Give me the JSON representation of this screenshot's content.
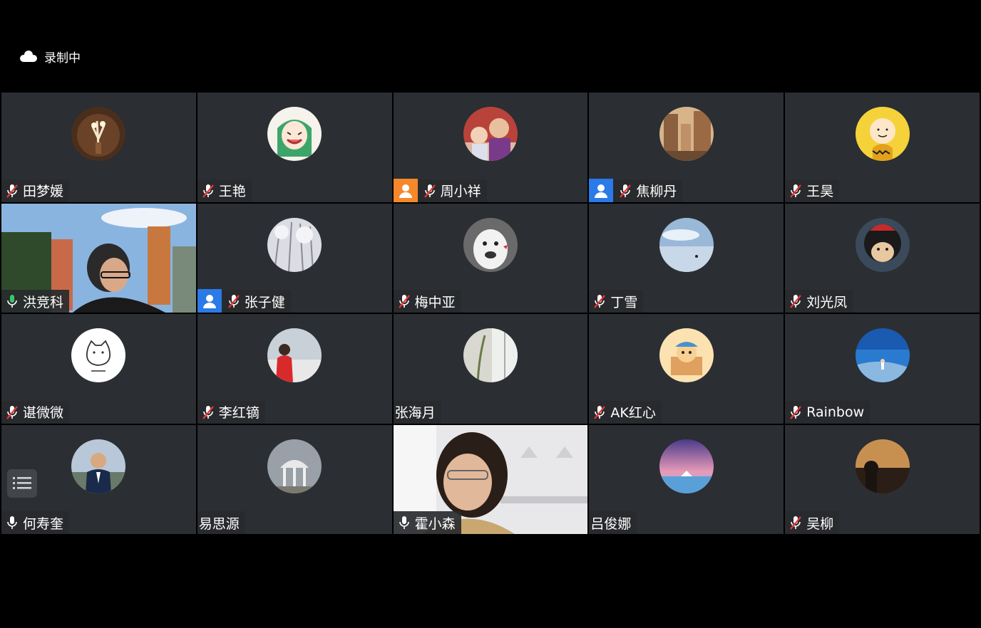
{
  "recording": {
    "label": "录制中"
  },
  "participants": [
    {
      "name": "田梦媛",
      "mic": "muted"
    },
    {
      "name": "王艳",
      "mic": "muted"
    },
    {
      "name": "周小祥",
      "mic": "muted",
      "role": "host"
    },
    {
      "name": "焦柳丹",
      "mic": "muted",
      "role": "cohost"
    },
    {
      "name": "王昊",
      "mic": "muted"
    },
    {
      "name": "洪竞科",
      "mic": "speaking",
      "video": true
    },
    {
      "name": "张子健",
      "mic": "muted",
      "role": "cohost"
    },
    {
      "name": "梅中亚",
      "mic": "muted"
    },
    {
      "name": "丁雪",
      "mic": "muted"
    },
    {
      "name": "刘光凤",
      "mic": "muted"
    },
    {
      "name": "谌微微",
      "mic": "muted"
    },
    {
      "name": "李红镝",
      "mic": "muted"
    },
    {
      "name": "张海月",
      "mic": "none"
    },
    {
      "name": "AK红心",
      "mic": "muted"
    },
    {
      "name": "Rainbow",
      "mic": "muted"
    },
    {
      "name": "何寿奎",
      "mic": "on"
    },
    {
      "name": "易思源",
      "mic": "none"
    },
    {
      "name": "霍小森",
      "mic": "on",
      "video": true
    },
    {
      "name": "吕俊娜",
      "mic": "none"
    },
    {
      "name": "吴柳",
      "mic": "muted"
    }
  ],
  "colors": {
    "tile_bg": "#2b2e33",
    "speaking": "#35c86a",
    "host": "#f5882a",
    "cohost": "#2a7ae8",
    "muted_slash": "#e53935"
  }
}
